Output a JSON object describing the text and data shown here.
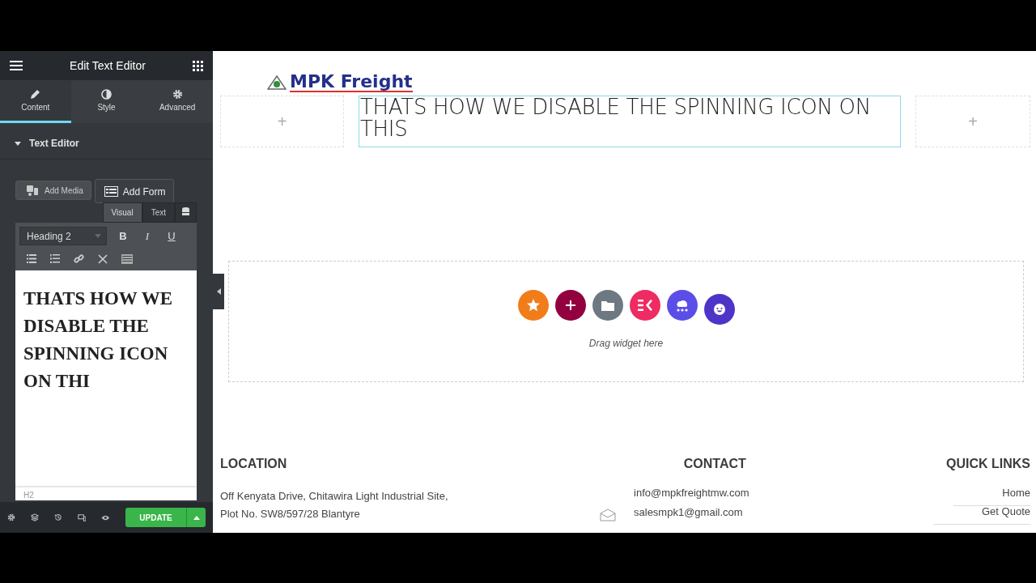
{
  "panel": {
    "title": "Edit Text Editor",
    "tabs": [
      {
        "label": "Content",
        "selected": true
      },
      {
        "label": "Style",
        "selected": false
      },
      {
        "label": "Advanced",
        "selected": false
      }
    ],
    "section": {
      "title": "Text Editor",
      "expanded": true
    },
    "media_buttons": [
      "Add Media",
      "Add Form"
    ],
    "editor_modes": [
      {
        "label": "Visual",
        "selected": true
      },
      {
        "label": "Text",
        "selected": false
      }
    ],
    "format_select": "Heading 2",
    "format_buttons": [
      "B",
      "I",
      "U"
    ],
    "content": "THATS HOW WE DISABLE THE SPINNING ICON ON THI",
    "path": "H2",
    "update_button": "UPDATE"
  },
  "canvas": {
    "logo": "MPK Freight",
    "column_plus": [
      "+",
      "+"
    ],
    "heading": "THATS HOW WE DISABLE THE SPINNING ICON ON THIS",
    "drop_zone": {
      "hint": "Drag widget here",
      "buttons": [
        {
          "color": "#f07d1a"
        },
        {
          "color": "#93003f"
        },
        {
          "color": "#6d7882"
        },
        {
          "color": "#ee2b62"
        },
        {
          "color": "#5b4ee8"
        },
        {
          "color": "#4f34c8"
        }
      ]
    },
    "footer": {
      "location": {
        "title": "LOCATION",
        "lines": [
          "Off Kenyata Drive, Chitawira Light Industrial Site,",
          "Plot No. SW8/597/28 Blantyre"
        ]
      },
      "contact": {
        "title": "CONTACT",
        "emails": [
          "info@mpkfreightmw.com",
          "salesmpk1@gmail.com"
        ]
      },
      "quick_links": {
        "title": "QUICK LINKS",
        "links": [
          "Home",
          "Get Quote"
        ]
      }
    }
  }
}
